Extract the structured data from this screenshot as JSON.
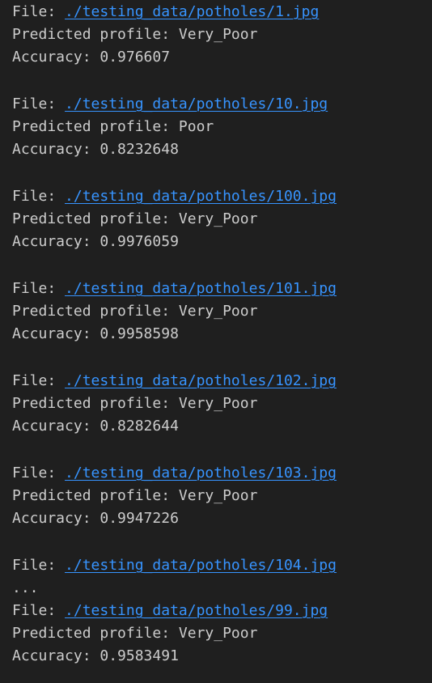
{
  "labels": {
    "file": "File: ",
    "predicted": "Predicted profile: ",
    "accuracy": "Accuracy: "
  },
  "entries": [
    {
      "path": "./testing_data/potholes/1.jpg",
      "profile": "Very_Poor",
      "accuracy": "0.976607"
    },
    {
      "path": "./testing_data/potholes/10.jpg",
      "profile": "Poor",
      "accuracy": "0.8232648"
    },
    {
      "path": "./testing_data/potholes/100.jpg",
      "profile": "Very_Poor",
      "accuracy": "0.9976059"
    },
    {
      "path": "./testing_data/potholes/101.jpg",
      "profile": "Very_Poor",
      "accuracy": "0.9958598"
    },
    {
      "path": "./testing_data/potholes/102.jpg",
      "profile": "Very_Poor",
      "accuracy": "0.8282644"
    },
    {
      "path": "./testing_data/potholes/103.jpg",
      "profile": "Very_Poor",
      "accuracy": "0.9947226"
    }
  ],
  "truncated_entry": {
    "path": "./testing_data/potholes/104.jpg"
  },
  "ellipsis": "...",
  "last_entry": {
    "path": "./testing_data/potholes/99.jpg",
    "profile": "Very_Poor",
    "accuracy": "0.9583491"
  }
}
